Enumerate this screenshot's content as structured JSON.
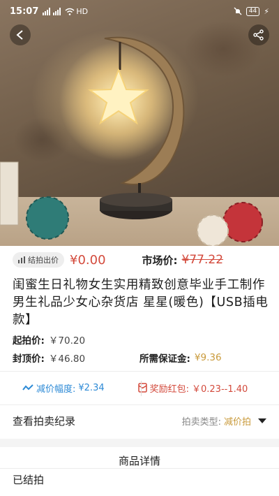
{
  "status_bar": {
    "time": "15:07",
    "network": "HD",
    "battery": "44"
  },
  "hero": {
    "icons": [
      "back-arrow-icon",
      "share-icon"
    ]
  },
  "auction": {
    "ended_tag": "结拍出价",
    "current_price": "¥0.00",
    "market_label": "市场价:",
    "market_price": "¥77.22"
  },
  "product": {
    "title": "闺蜜生日礼物女生实用精致创意毕业手工制作男生礼品少女心杂货店 星星(暖色)【USB插电款】"
  },
  "prices": {
    "start_label": "起拍价:",
    "start_value": "￥70.20",
    "cap_label": "封顶价:",
    "cap_value": "￥46.80",
    "deposit_label": "所需保证金:",
    "deposit_value": "¥9.36"
  },
  "metrics": {
    "drop_label": "减价幅度:",
    "drop_value": "¥2.34",
    "reward_label": "奖励红包:",
    "reward_value": "￥0.23--1.40"
  },
  "records": {
    "link": "查看拍卖纪录",
    "type_label": "拍卖类型:",
    "type_value": "减价拍"
  },
  "detail": {
    "heading": "商品详情",
    "status": "已结拍"
  },
  "colors": {
    "price_red": "#d34a3c",
    "gold": "#c99a3b",
    "blue": "#2d8ad6"
  }
}
